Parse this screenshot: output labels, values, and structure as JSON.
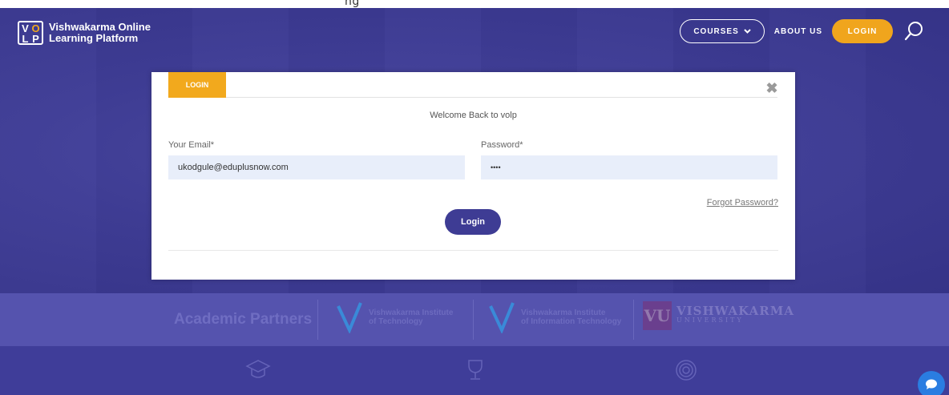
{
  "top_strip": {
    "text": "ng"
  },
  "header": {
    "logo_letters": [
      "V",
      "O",
      "L",
      "P"
    ],
    "logo_line1": "Vishwakarma Online",
    "logo_line2": "Learning Platform",
    "nav": {
      "courses": "COURSES",
      "about": "ABOUT US",
      "login": "LOGIN"
    }
  },
  "modal": {
    "tab_label": "LOGIN",
    "close_symbol": "✖",
    "welcome": "Welcome Back to volp",
    "email_label": "Your Email*",
    "email_value": "ukodgule@eduplusnow.com",
    "password_label": "Password*",
    "password_value": "••••",
    "forgot": "Forgot Password?",
    "submit": "Login"
  },
  "partners": {
    "title": "Academic Partners",
    "items": [
      {
        "line1": "Vishwakarma Institute",
        "line2": "of Technology"
      },
      {
        "line1": "Vishwakarma Institute",
        "line2": "of Information Technology"
      }
    ],
    "university_mark": "VU",
    "university_name": "VISHWAKARMA",
    "university_sub": "UNIVERSITY"
  },
  "colors": {
    "accent_orange": "#f2a91d",
    "brand_purple": "#3e3c94",
    "input_bg": "#e8eefa",
    "chat_blue": "#2a7de1"
  }
}
